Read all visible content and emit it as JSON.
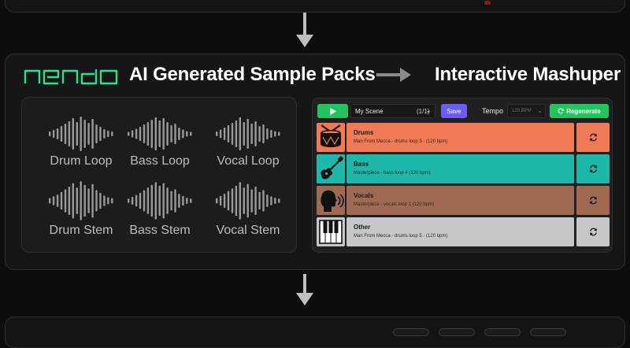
{
  "logo": {
    "text": "nendo"
  },
  "headings": {
    "sample_packs": "AI Generated Sample Packs",
    "mashuper": "Interactive Mashuper"
  },
  "samples": [
    {
      "label": "Drum Loop"
    },
    {
      "label": "Bass Loop"
    },
    {
      "label": "Vocal Loop"
    },
    {
      "label": "Drum Stem"
    },
    {
      "label": "Bass Stem"
    },
    {
      "label": "Vocal Stem"
    }
  ],
  "toolbar": {
    "scene_name": "My Scene",
    "scene_count": "(1/1)",
    "save_label": "Save",
    "tempo_label": "Tempo",
    "tempo_value": "120 BPM",
    "regenerate_label": "Regenerate"
  },
  "tracks": [
    {
      "name": "Drums",
      "source": "Man From Mecca - drums loop 3 - (120 bpm)",
      "color": "#f07a56",
      "icon": "drum-icon"
    },
    {
      "name": "Bass",
      "source": "Masterpiece - bass loop 4 (120 bpm)",
      "color": "#1eb8ab",
      "icon": "guitar-icon"
    },
    {
      "name": "Vocals",
      "source": "Masterpiece - vocals loop 1 (120 bpm)",
      "color": "#a06a52",
      "icon": "speaking-head-icon"
    },
    {
      "name": "Other",
      "source": "Man From Mecca - drums loop 5 - (120 bpm)",
      "color": "#c4c8ca",
      "icon": "piano-keys-icon"
    }
  ],
  "colors": {
    "accent_green": "#22c45e",
    "save_purple": "#6a5cf0",
    "logo_green": "#2fe08a"
  }
}
